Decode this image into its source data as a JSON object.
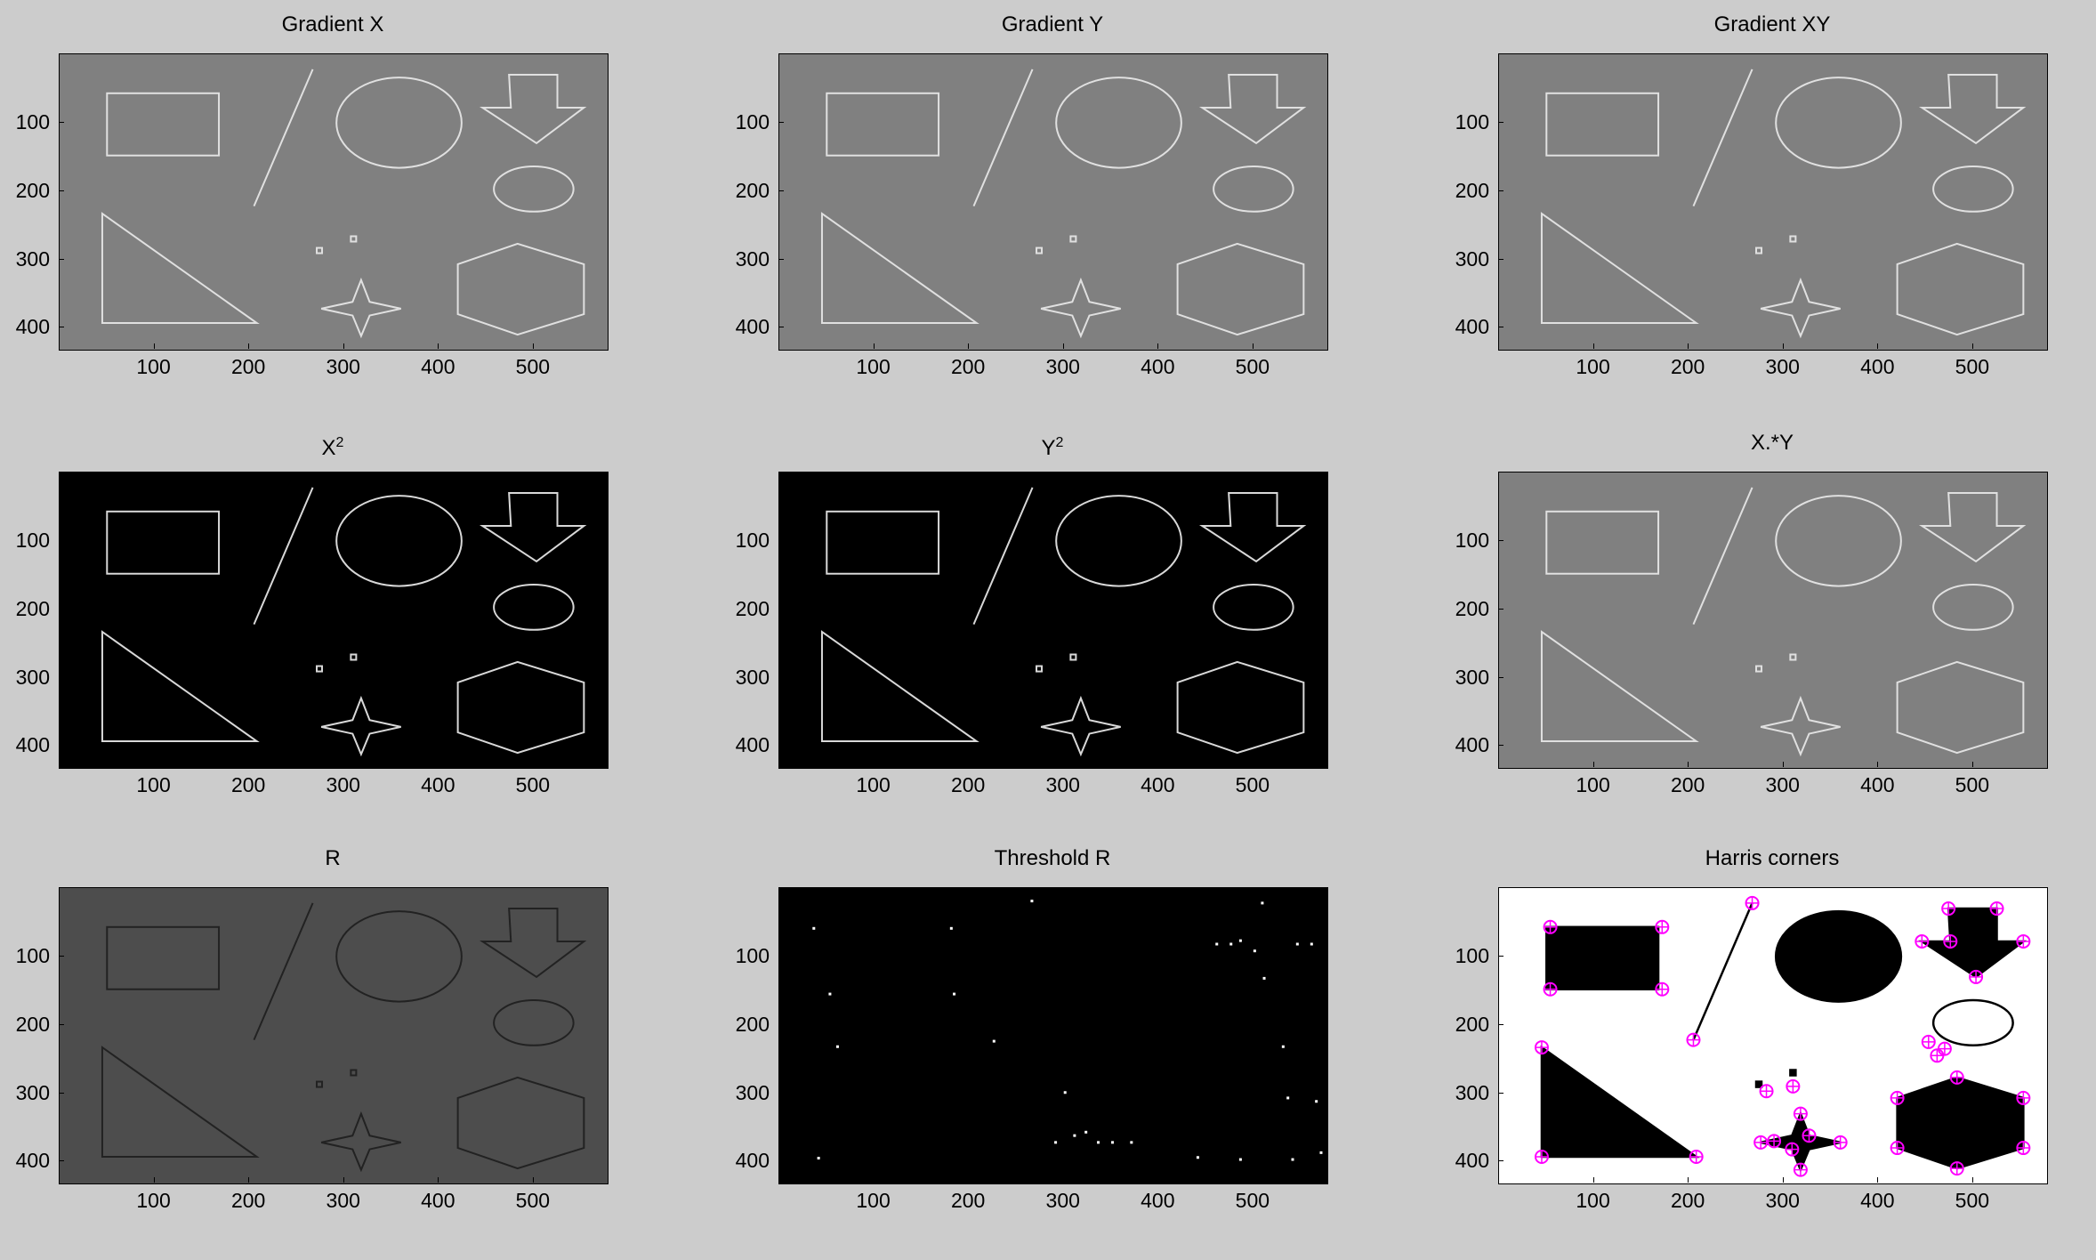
{
  "figure": {
    "background": "#cccccc",
    "panels": [
      {
        "id": "grad-x",
        "title": "Gradient X",
        "sup": "",
        "style": "gray"
      },
      {
        "id": "grad-y",
        "title": "Gradient Y",
        "sup": "",
        "style": "gray"
      },
      {
        "id": "grad-xy",
        "title": "Gradient XY",
        "sup": "",
        "style": "gray"
      },
      {
        "id": "x2",
        "title": "X",
        "sup": "2",
        "style": "black"
      },
      {
        "id": "y2",
        "title": "Y",
        "sup": "2",
        "style": "black"
      },
      {
        "id": "xy",
        "title": "X.*Y",
        "sup": "",
        "style": "gray"
      },
      {
        "id": "r",
        "title": "R",
        "sup": "",
        "style": "darkgray"
      },
      {
        "id": "threshold-r",
        "title": "Threshold R",
        "sup": "",
        "style": "threshold"
      },
      {
        "id": "harris",
        "title": "Harris corners",
        "sup": "",
        "style": "white"
      }
    ],
    "x_ticks": [
      "100",
      "200",
      "300",
      "400",
      "500"
    ],
    "y_ticks": [
      "100",
      "200",
      "300",
      "400"
    ],
    "x_range": [
      0,
      578
    ],
    "y_range": [
      0,
      432
    ],
    "colors": {
      "gray_bg": "#808080",
      "darkgray_bg": "#4d4d4d",
      "black_bg": "#000000",
      "white_bg": "#ffffff",
      "corner_marker": "#ff00ff"
    }
  }
}
